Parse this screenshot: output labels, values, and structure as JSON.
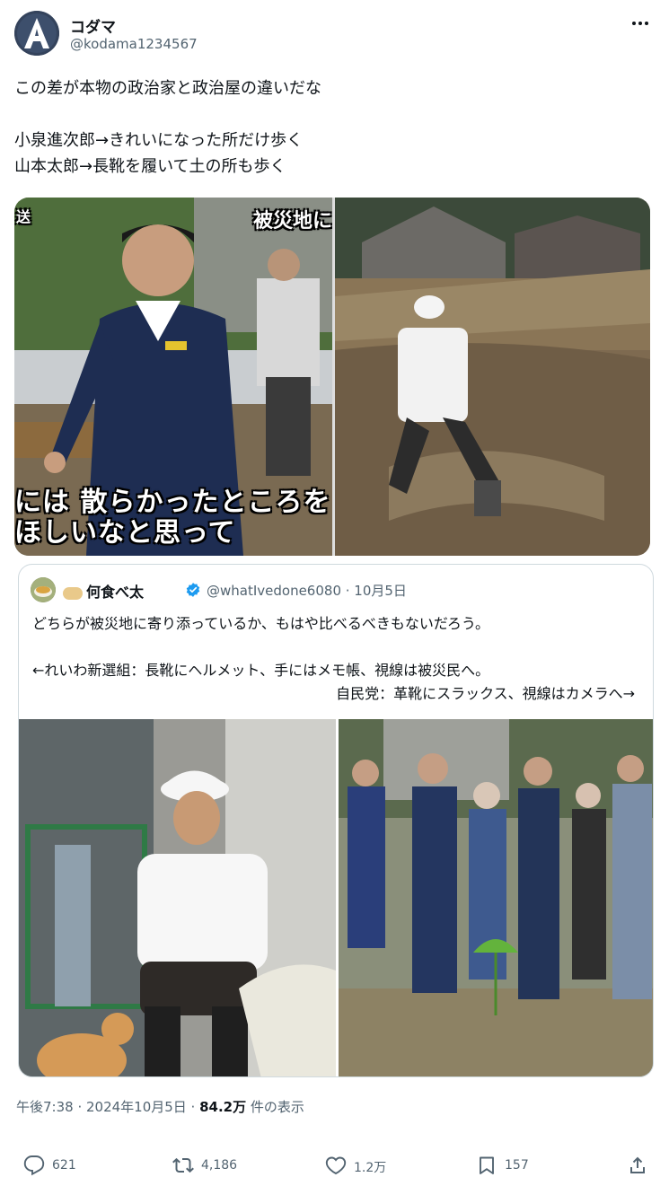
{
  "author": {
    "display_name": "コダマ",
    "handle": "@kodama1234567",
    "avatar_letter": "A"
  },
  "more_icon": "more-dots-icon",
  "tweet": {
    "text": "この差が本物の政治家と政治屋の違いだな\n\n小泉進次郎→きれいになった所だけ歩く\n山本太郎→長靴を履いて土の所も歩く"
  },
  "media": {
    "left_caption_top_left": "送",
    "left_caption_top_right": "被災地に",
    "left_caption_bottom_1": "には 散らかったところを",
    "left_caption_bottom_2": "ほしいなと思って"
  },
  "quote": {
    "display_name": "何食べ太",
    "verified_icon": "verified-badge-icon",
    "handle_date": "@whatIvedone6080 · 10月5日",
    "line1": "どちらが被災地に寄り添っているか、もはや比べるべきもないだろう。",
    "line2": "←れいわ新選組：長靴にヘルメット、手にはメモ帳、視線は被災民へ。",
    "line3": "自民党：革靴にスラックス、視線はカメラへ→"
  },
  "meta": {
    "time": "午後7:38 · 2024年10月5日 · ",
    "views": "84.2万",
    "views_suffix": " 件の表示"
  },
  "actions": {
    "reply_count": "621",
    "retweet_count": "4,186",
    "like_count": "1.2万",
    "bookmark_count": "157"
  },
  "colors": {
    "text_primary": "#0f1419",
    "text_secondary": "#536471",
    "border": "#cfd9de",
    "verified": "#1d9bf0"
  }
}
